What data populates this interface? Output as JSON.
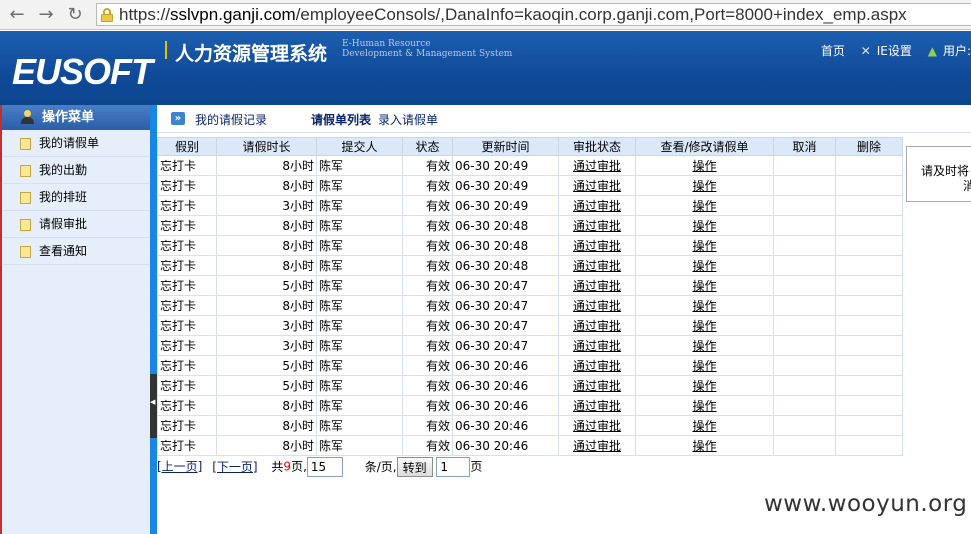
{
  "browser": {
    "url_scheme": "https://",
    "url_domain": "sslvpn.ganji.com",
    "url_rest": "/employeeConsols/,DanaInfo=kaoqin.corp.ganji.com,Port=8000+index_emp.aspx"
  },
  "header": {
    "logo": "EUSOFT",
    "title": "人力资源管理系统",
    "subtitle_line1": "E-Human Resource",
    "subtitle_line2": "Development & Management System",
    "home": "首页",
    "ie_settings": "IE设置",
    "user_label": "用户:"
  },
  "sidebar": {
    "heading": "操作菜单",
    "items": [
      {
        "label": "我的请假单"
      },
      {
        "label": "我的出勤"
      },
      {
        "label": "我的排班"
      },
      {
        "label": "请假审批"
      },
      {
        "label": "查看通知"
      }
    ]
  },
  "breadcrumb": {
    "record": "我的请假记录",
    "list": "请假单列表",
    "enter": "录入请假单"
  },
  "table": {
    "columns": [
      "假别",
      "请假时长",
      "提交人",
      "状态",
      "更新时间",
      "审批状态",
      "查看/修改请假单",
      "取消",
      "删除"
    ],
    "rows": [
      {
        "type": "忘打卡",
        "duration": "8小时",
        "submitter": "陈军",
        "status": "有效",
        "updated": "06-30 20:49",
        "approval": "通过审批",
        "action": "操作"
      },
      {
        "type": "忘打卡",
        "duration": "8小时",
        "submitter": "陈军",
        "status": "有效",
        "updated": "06-30 20:49",
        "approval": "通过审批",
        "action": "操作"
      },
      {
        "type": "忘打卡",
        "duration": "3小时",
        "submitter": "陈军",
        "status": "有效",
        "updated": "06-30 20:49",
        "approval": "通过审批",
        "action": "操作"
      },
      {
        "type": "忘打卡",
        "duration": "8小时",
        "submitter": "陈军",
        "status": "有效",
        "updated": "06-30 20:48",
        "approval": "通过审批",
        "action": "操作"
      },
      {
        "type": "忘打卡",
        "duration": "8小时",
        "submitter": "陈军",
        "status": "有效",
        "updated": "06-30 20:48",
        "approval": "通过审批",
        "action": "操作"
      },
      {
        "type": "忘打卡",
        "duration": "8小时",
        "submitter": "陈军",
        "status": "有效",
        "updated": "06-30 20:48",
        "approval": "通过审批",
        "action": "操作"
      },
      {
        "type": "忘打卡",
        "duration": "5小时",
        "submitter": "陈军",
        "status": "有效",
        "updated": "06-30 20:47",
        "approval": "通过审批",
        "action": "操作"
      },
      {
        "type": "忘打卡",
        "duration": "8小时",
        "submitter": "陈军",
        "status": "有效",
        "updated": "06-30 20:47",
        "approval": "通过审批",
        "action": "操作"
      },
      {
        "type": "忘打卡",
        "duration": "3小时",
        "submitter": "陈军",
        "status": "有效",
        "updated": "06-30 20:47",
        "approval": "通过审批",
        "action": "操作"
      },
      {
        "type": "忘打卡",
        "duration": "3小时",
        "submitter": "陈军",
        "status": "有效",
        "updated": "06-30 20:47",
        "approval": "通过审批",
        "action": "操作"
      },
      {
        "type": "忘打卡",
        "duration": "5小时",
        "submitter": "陈军",
        "status": "有效",
        "updated": "06-30 20:46",
        "approval": "通过审批",
        "action": "操作"
      },
      {
        "type": "忘打卡",
        "duration": "5小时",
        "submitter": "陈军",
        "status": "有效",
        "updated": "06-30 20:46",
        "approval": "通过审批",
        "action": "操作"
      },
      {
        "type": "忘打卡",
        "duration": "8小时",
        "submitter": "陈军",
        "status": "有效",
        "updated": "06-30 20:46",
        "approval": "通过审批",
        "action": "操作"
      },
      {
        "type": "忘打卡",
        "duration": "8小时",
        "submitter": "陈军",
        "status": "有效",
        "updated": "06-30 20:46",
        "approval": "通过审批",
        "action": "操作"
      },
      {
        "type": "忘打卡",
        "duration": "8小时",
        "submitter": "陈军",
        "status": "有效",
        "updated": "06-30 20:46",
        "approval": "通过审批",
        "action": "操作"
      }
    ]
  },
  "pager": {
    "prev": "[上一页]",
    "next": "[下一页]",
    "total_prefix": "共",
    "total_pages": "9",
    "total_suffix": "页,",
    "page_size": "15",
    "page_size_suffix": "条/页,",
    "goto": "转到",
    "page": "1",
    "page_suffix": "页"
  },
  "notice": {
    "line1": "请及时将",
    "line2": "消"
  },
  "watermark": "www.wooyun.org"
}
